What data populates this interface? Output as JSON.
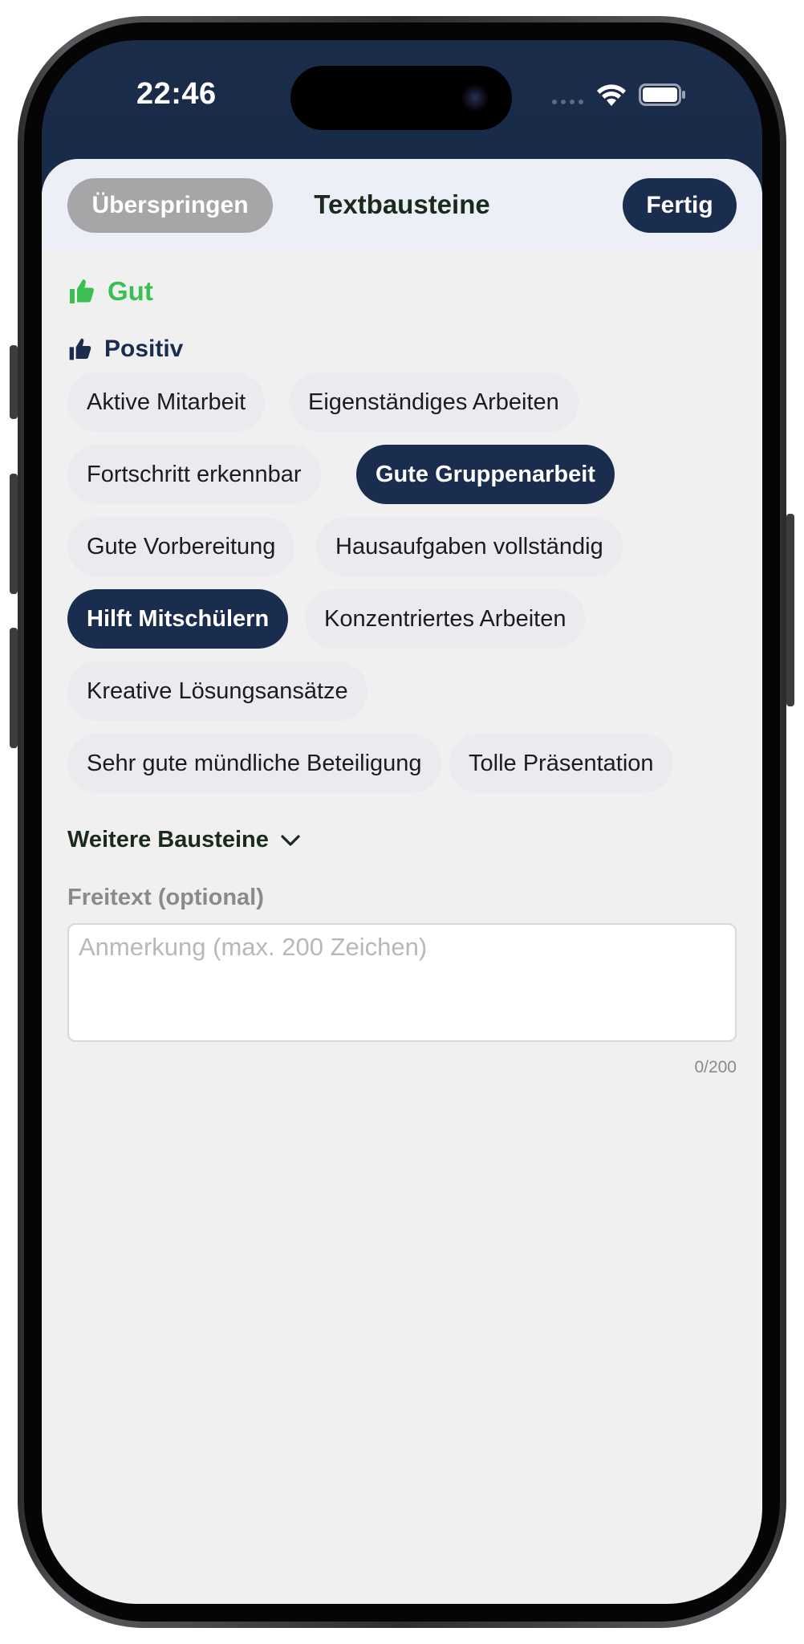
{
  "status_bar": {
    "time": "22:46"
  },
  "header": {
    "skip_label": "Überspringen",
    "title": "Textbausteine",
    "done_label": "Fertig"
  },
  "rating": {
    "label": "Gut",
    "icon": "thumbs-up-icon",
    "color": "#3bbf52"
  },
  "category": {
    "label": "Positiv",
    "icon": "thumbs-up-icon",
    "color": "#1b2d4f"
  },
  "chips": [
    {
      "label": "Aktive Mitarbeit",
      "selected": false
    },
    {
      "label": "Eigenständiges Arbeiten",
      "selected": false
    },
    {
      "label": "Fortschritt erkennbar",
      "selected": false
    },
    {
      "label": "Gute Gruppenarbeit",
      "selected": true
    },
    {
      "label": "Gute Vorbereitung",
      "selected": false
    },
    {
      "label": "Hausaufgaben vollständig",
      "selected": false
    },
    {
      "label": "Hilft Mitschülern",
      "selected": true
    },
    {
      "label": "Konzentriertes Arbeiten",
      "selected": false
    },
    {
      "label": "Kreative Lösungsansätze",
      "selected": false
    },
    {
      "label": "Sehr gute mündliche Beteiligung",
      "selected": false
    },
    {
      "label": "Tolle Präsentation",
      "selected": false
    }
  ],
  "more": {
    "label": "Weitere Bausteine",
    "icon": "chevron-down-icon"
  },
  "freitext": {
    "label": "Freitext (optional)",
    "placeholder": "Anmerkung (max. 200 Zeichen)",
    "value": "",
    "counter": "0/200"
  },
  "colors": {
    "primary": "#1b2d4f",
    "good": "#3bbf52",
    "chip_bg": "#ebebef",
    "skip_bg": "#a6a6a8"
  }
}
